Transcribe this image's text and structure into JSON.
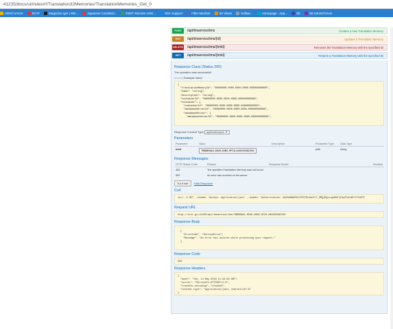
{
  "browser": {
    "url": ":41235/docs/ui/index#!/Translation32Memories/TranslationMemories_Get_0",
    "bookmarks": [
      {
        "label": "ARSO vreme",
        "color": "#f4b400"
      },
      {
        "label": "ECAT",
        "color": "#e53935"
      },
      {
        "label": "Magazine igre | MO...",
        "color": "#1b1b1b"
      },
      {
        "label": "Japanese Candlesti...",
        "color": "#e53935"
      },
      {
        "label": "ESET Remote Admi...",
        "color": "#43a047"
      },
      {
        "label": "SEK Support",
        "color": "#1e88e5"
      },
      {
        "label": "Filter Member",
        "color": "#5c6bc0"
      },
      {
        "label": "50 Views",
        "color": "#fb8c00"
      },
      {
        "label": "Softwe...",
        "color": "#90a4ae"
      },
      {
        "label": "Homepage - App...",
        "color": "#00acc1"
      },
      {
        "label": "ZE",
        "color": "#3949ab"
      },
      {
        "label": "SE tutorial forum",
        "color": "#8e24aa"
      }
    ]
  },
  "operations": [
    {
      "verb": "POST",
      "path": "/api/tmservice/tms",
      "desc": "Creates a new Translation Memory",
      "cls": "post"
    },
    {
      "verb": "PUT",
      "path": "/api/tmservice/tms/{id}",
      "desc": "Updates a Translation Memory",
      "cls": "put"
    },
    {
      "verb": "DELETE",
      "path": "/api/tmservice/tms/{tmId}",
      "desc": "Removes the Translation Memory with the specified ID",
      "cls": "del"
    },
    {
      "verb": "GET",
      "path": "/api/tmservice/tms/{tmId}",
      "desc": "Returns a Translation Memory with the specified ID",
      "cls": "get"
    }
  ],
  "expanded": {
    "response_class_title": "Response Class (Status 200)",
    "response_class_desc": "The operation was successfull",
    "model_label": "Model",
    "example_label": "Example Value",
    "example_json": "{\n  \"translationMemoryId\": \"00000000-0000-0000-0000-000000000000\",\n  \"name\": \"string\",\n  \"description\": \"string\",\n  \"containerId\": \"00000000-0000-0000-0000-000000000000\",\n  \"container\": {\n    \"containerId\": \"00000000-0000-0000-0000-000000000000\",\n    \"databaseServerId\": \"00000000-0000-0000-0000-000000000000\",\n    \"databaseServer\": {\n      \"databaseServerId\": \"00000000-0000-0000-0000-000000000000\",",
    "content_type_label": "Response Content Type",
    "content_type_value": "application/json ▼",
    "parameters_title": "Parameters",
    "param_headers": [
      "Parameter",
      "Value",
      "Description",
      "Parameter Type",
      "Data Type"
    ],
    "param_row": {
      "name": "tmId",
      "value": "7BBB98A1-8549-40B2-9FC8-A4926538C502",
      "desc": "",
      "ptype": "path",
      "dtype": "string"
    },
    "messages_title": "Response Messages",
    "msg_headers": [
      "HTTP Status Code",
      "Reason",
      "Response Model",
      "Headers"
    ],
    "msg_rows": [
      {
        "code": "404",
        "reason": "The specified Translation Memory was not found"
      },
      {
        "code": "500",
        "reason": "An error has occured on the server"
      }
    ],
    "try_label": "Try it out!",
    "hide_label": "Hide Response",
    "curl_title": "Curl",
    "curl_text": "curl -X GET --header 'Accept: application/json' --header 'Authorization: AAIAAHWdRIhLSPV7Ht4mc3l7_HMQjKQxxug4KUFjDspFCdrmHYi73oETF",
    "request_url_title": "Request URL",
    "request_url": "http://srvr-gs:41235/api/tmservice/tms/7BBB98A1-8549-40B2-9FC8-A4926538C502",
    "response_body_title": "Response Body",
    "response_body": "{\n  \"ErrorCode\": \"ServiceError\",\n  \"Message\": \"An error has occured while processing your request.\"\n}",
    "response_code_title": "Response Code",
    "response_code": "500",
    "response_headers_title": "Response Headers",
    "response_headers": "{\n  \"date\": \"Tue, 14 May 2019 11:43:36 GMT\",\n  \"server\": \"Microsoft-HTTPAPI/2.0\",\n  \"transfer-encoding\": \"chunked\",\n  \"content-type\": \"application/json; charset=utf-8\"\n}"
  }
}
